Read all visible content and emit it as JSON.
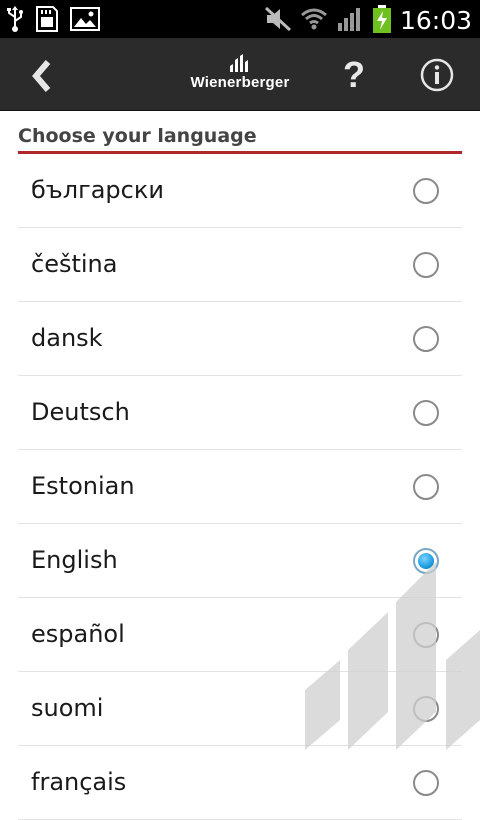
{
  "status_bar": {
    "time": "16:03",
    "icons": [
      "usb-icon",
      "sd-card-icon",
      "image-icon",
      "mute-icon",
      "wifi-icon",
      "signal-icon",
      "battery-charging-icon"
    ]
  },
  "app_bar": {
    "logo_text": "Wienerberger",
    "help_label": "?",
    "icons": [
      "back-chevron-icon",
      "info-icon"
    ]
  },
  "section": {
    "title": "Choose your language"
  },
  "languages": [
    {
      "label": "български",
      "selected": false
    },
    {
      "label": "čeština",
      "selected": false
    },
    {
      "label": "dansk",
      "selected": false
    },
    {
      "label": "Deutsch",
      "selected": false
    },
    {
      "label": "Estonian",
      "selected": false
    },
    {
      "label": "English",
      "selected": true
    },
    {
      "label": "español",
      "selected": false
    },
    {
      "label": "suomi",
      "selected": false
    },
    {
      "label": "français",
      "selected": false
    }
  ],
  "colors": {
    "accent_rule": "#b0262b",
    "radio_selected": "#23a3e6",
    "app_bar": "#2b2b2b"
  }
}
